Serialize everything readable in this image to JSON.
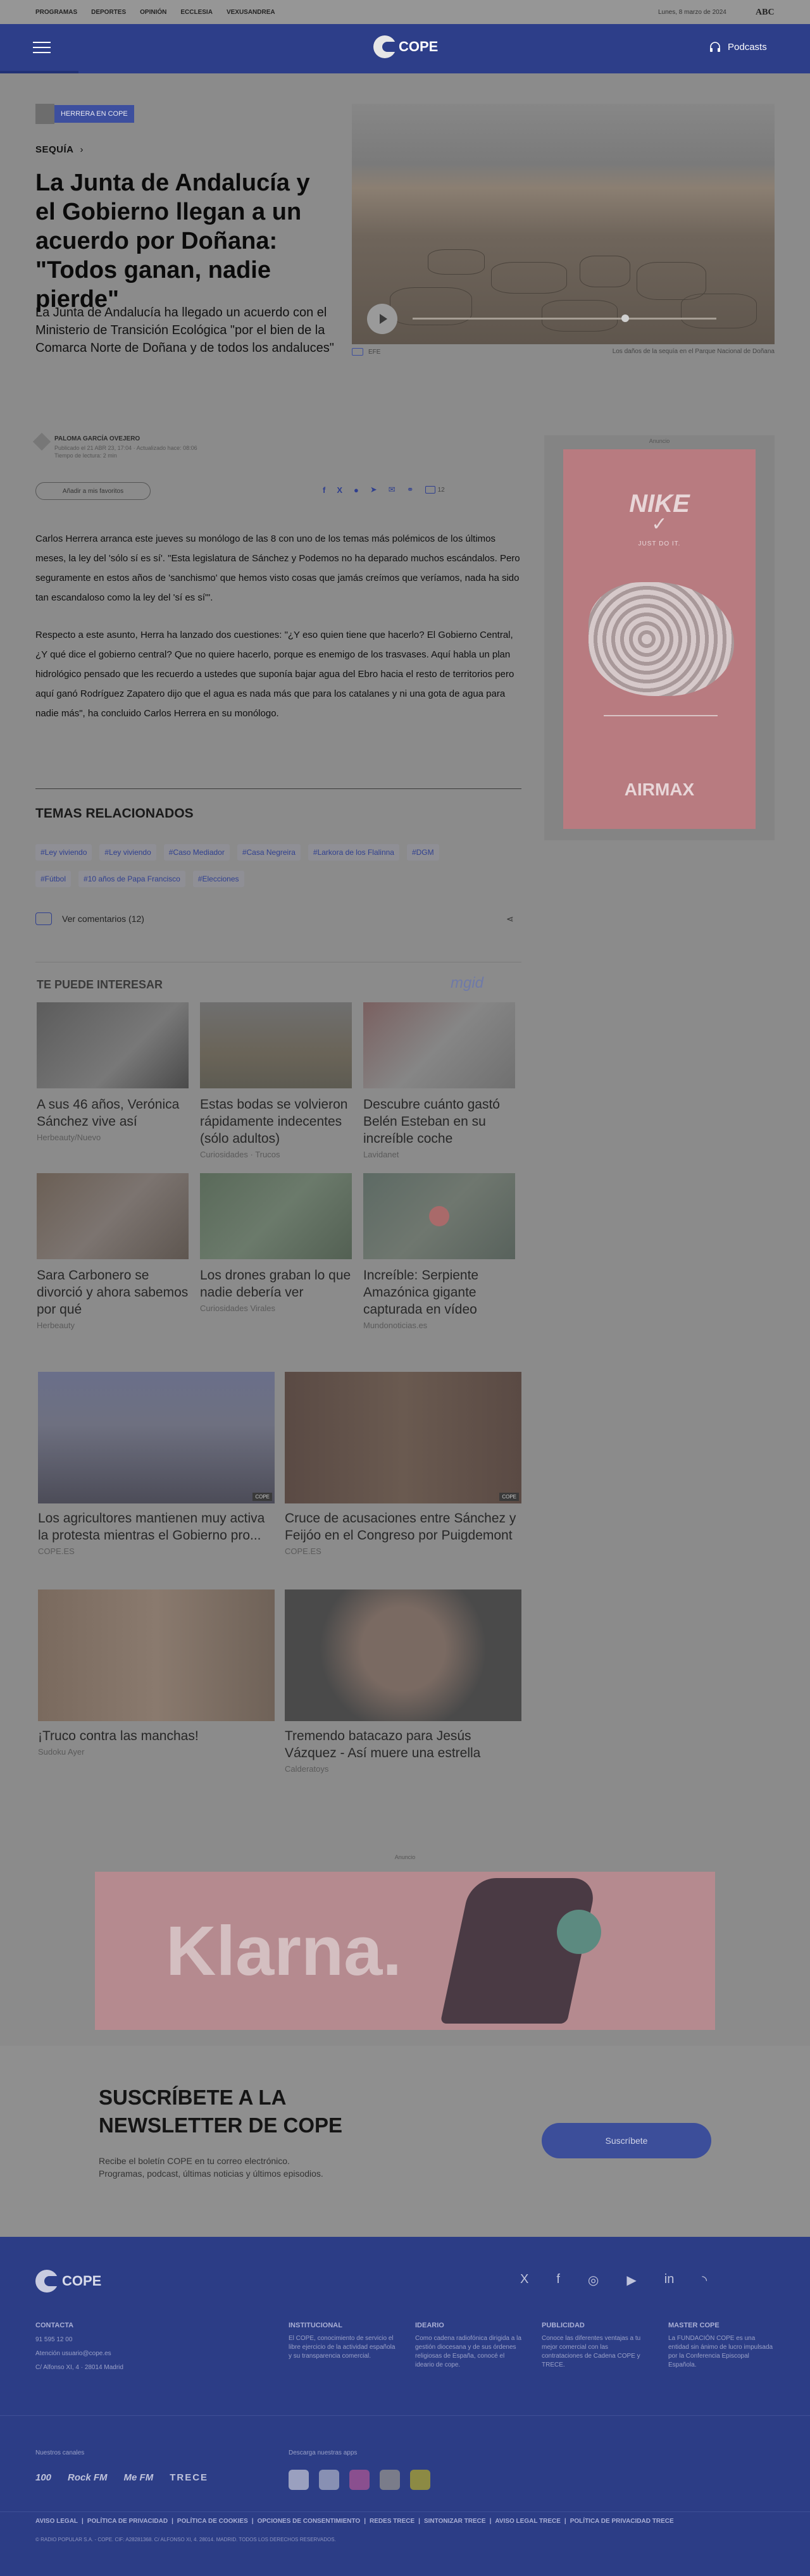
{
  "topbar": {
    "nav": [
      "PROGRAMAS",
      "DEPORTES",
      "OPINIÓN",
      "ECCLESIA",
      "VEXUSANDREA"
    ],
    "date": "Lunes, 8 marzo de 2024",
    "abc": "ABC"
  },
  "header": {
    "logo": "COPE",
    "podcasts": "Podcasts"
  },
  "article": {
    "program_badge": "HERRERA EN COPE",
    "section": "SEQUÍA",
    "title": "La Junta de Andalucía y el Gobierno llegan a un acuerdo por Doñana: \"Todos ganan, nadie pierde\"",
    "lead": "La Junta de Andalucía ha llegado un acuerdo con el Ministerio de Transición Ecológica \"por el bien de la Comarca Norte de Doñana y de todos los andaluces\"",
    "image_agency": "EFE",
    "image_caption": "Los daños de la sequía en el Parque Nacional de Doñana",
    "author": "PALOMA GARCÍA OVEJERO",
    "published": "Publicado el 21 ABR 23, 17:04 · Actualizado hace: 08:06",
    "reading_time": "Tiempo de lectura: 2 min",
    "add_favorites": "Añadir a mis favoritos",
    "comments_count": "12",
    "paragraphs": [
      "Carlos Herrera arranca este jueves su monólogo de las 8 con uno de los temas más polémicos de los últimos meses, la ley del 'sólo sí es sí'. \"Esta legislatura de Sánchez y Podemos no ha deparado muchos escándalos. Pero seguramente en estos años de 'sanchismo' que hemos visto cosas que jamás creímos que veríamos, nada ha sido tan escandaloso como la ley del 'sí es sí'\".",
      "Respecto a este asunto, Herra ha lanzado dos cuestiones: \"¿Y eso quien tiene que hacerlo? El Gobierno Central, ¿Y qué dice el gobierno central? Que no quiere hacerlo, porque es enemigo de los trasvases. Aquí habla un plan hidrológico pensado que les recuerdo a ustedes que suponía bajar agua del Ebro hacia el resto de territorios pero aquí ganó Rodríguez Zapatero dijo que el agua es nada más que para los catalanes y ni una gota de agua para nadie más\", ha concluido Carlos Herrera en su monólogo."
    ],
    "related_title": "TEMAS RELACIONADOS",
    "tags_row1": [
      "#Ley viviendo",
      "#Ley viviendo",
      "#Caso Mediador",
      "#Casa Negreira",
      "#Larkora de los Flalinna",
      "#DGM"
    ],
    "tags_row2": [
      "#Fútbol",
      "#10 años de Papa Francisco",
      "#Elecciones"
    ],
    "see_comments": "Ver comentarios (12)"
  },
  "ad_label": "Anuncio",
  "nike_ad": {
    "tagline": "JUST DO IT.",
    "brand": "AIRMAX"
  },
  "interest": {
    "title": "TE PUEDE INTERESAR",
    "provider": "mgid",
    "cards": [
      {
        "title": "A sus 46 años, Verónica Sánchez vive así",
        "source": "Herbeauty/Nuevo"
      },
      {
        "title": "Estas bodas se volvieron rápidamente indecentes (sólo adultos)",
        "source": "Curiosidades · Trucos"
      },
      {
        "title": "Descubre cuánto gastó Belén Esteban en su increíble coche",
        "source": "Lavidanet"
      },
      {
        "title": "Sara Carbonero se divorció y ahora sabemos por qué",
        "source": "Herbeauty"
      },
      {
        "title": "Los drones graban lo que nadie debería ver",
        "source": "Curiosidades Virales"
      },
      {
        "title": "Increíble: Serpiente Amazónica gigante capturada en vídeo",
        "source": "Mundonoticias.es"
      }
    ]
  },
  "cope_cards": [
    {
      "title": "Los agricultores mantienen muy activa la protesta mientras el Gobierno pro...",
      "source": "COPE.ES"
    },
    {
      "title": "Cruce de acusaciones entre Sánchez y Feijóo en el Congreso por Puigdemont",
      "source": "COPE.ES"
    },
    {
      "title": "¡Truco contra las manchas!",
      "source": "Sudoku Ayer"
    },
    {
      "title": "Tremendo batacazo para Jesús Vázquez - Así muere una estrella",
      "source": "Calderatoys"
    }
  ],
  "klarna_ad": {
    "brand": "Klarna."
  },
  "newsletter": {
    "title_line1": "SUSCRÍBETE A LA",
    "title_line2": "NEWSLETTER DE COPE",
    "desc": "Recibe el boletín COPE en tu correo electrónico. Programas, podcast, últimas noticias y últimos episodios.",
    "button": "Suscríbete"
  },
  "footer": {
    "logo": "COPE",
    "contact_title": "CONTACTA",
    "contact_items": [
      "91 595 12 00",
      "Atención usuario@cope.es",
      "C/ Alfonso XI, 4 · 28014 Madrid"
    ],
    "columns": [
      {
        "title": "INSTITUCIONAL",
        "text": "El COPE, conocimiento de servicio el libre ejercicio de la actividad española y su transparencia comercial."
      },
      {
        "title": "IDEARIO",
        "text": "Como cadena radiofónica dirigida a la gestión diocesana y de sus órdenes religiosas de España, conocé el ideario de cope."
      },
      {
        "title": "PUBLICIDAD",
        "text": "Conoce las diferentes ventajas a tu mejor comercial con las contrataciones de Cadena COPE y TRECE."
      },
      {
        "title": "MASTER COPE",
        "text": "La FUNDACIÓN COPE es una entidad sin ánimo de lucro impulsada por la Conferencia Episcopal Española."
      }
    ],
    "our_channels": "Nuestros canales",
    "download_apps": "Descarga nuestras apps",
    "channels": [
      "100",
      "Rock FM",
      "Me FM",
      "TRECE"
    ],
    "legal_links": [
      "AVISO LEGAL",
      "POLÍTICA DE PRIVACIDAD",
      "POLÍTICA DE COOKIES",
      "OPCIONES DE CONSENTIMIENTO",
      "REDES TRECE",
      "SINTONIZAR TRECE",
      "AVISO LEGAL TRECE",
      "POLÍTICA DE PRIVACIDAD TRECE"
    ],
    "copyright": "© RADIO POPULAR S.A. - COPE. CIF: A28281368. C/ ALFONSO XI, 4. 28014. MADRID. TODOS LOS DERECHOS RESERVADOS."
  }
}
